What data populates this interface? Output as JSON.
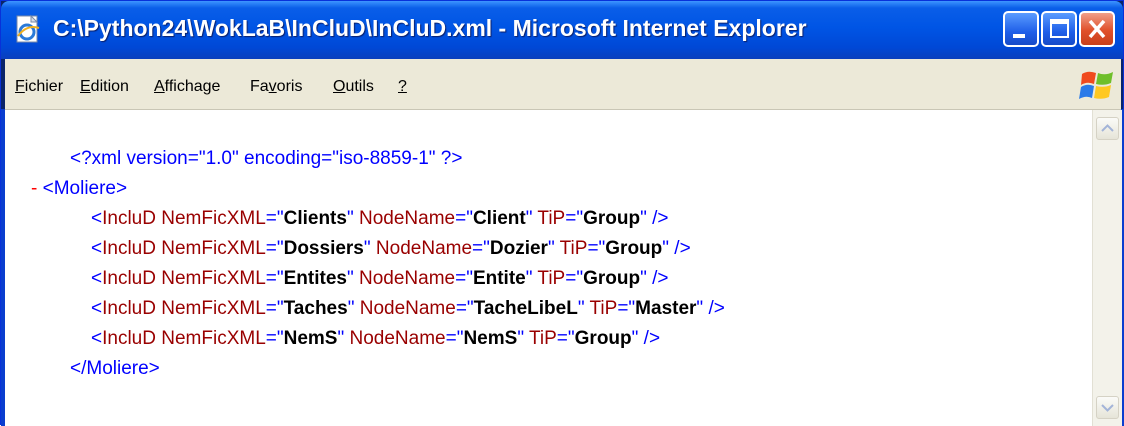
{
  "window": {
    "title": "C:\\Python24\\WokLaB\\InCluD\\InCluD.xml - Microsoft Internet Explorer"
  },
  "menu": {
    "items": [
      {
        "mnemonic": "F",
        "rest": "ichier"
      },
      {
        "mnemonic": "E",
        "rest": "dition"
      },
      {
        "mnemonic": "A",
        "rest": "ffichage"
      },
      {
        "pre": "Fa",
        "mnemonic": "v",
        "rest": "oris"
      },
      {
        "mnemonic": "O",
        "rest": "utils"
      },
      {
        "mnemonic": "?",
        "rest": ""
      }
    ]
  },
  "xml": {
    "declaration": "<?xml version=\"1.0\" encoding=\"iso-8859-1\" ?>",
    "collapse_marker": "-",
    "root_open": "<Moliere>",
    "root_close": "</Moliere>",
    "element_name": "IncluD",
    "attr1": "NemFicXML",
    "attr2": "NodeName",
    "attr3": "TiP",
    "rows": [
      {
        "nemficxml": "Clients",
        "nodename": "Client",
        "tip": "Group"
      },
      {
        "nemficxml": "Dossiers",
        "nodename": "Dozier",
        "tip": "Group"
      },
      {
        "nemficxml": "Entites",
        "nodename": "Entite",
        "tip": "Group"
      },
      {
        "nemficxml": "Taches",
        "nodename": "TacheLibeL",
        "tip": "Master"
      },
      {
        "nemficxml": "NemS",
        "nodename": "NemS",
        "tip": "Group"
      }
    ]
  },
  "colors": {
    "markup": "#0000ff",
    "names": "#990000",
    "values": "#000000",
    "collapse": "#ff0000",
    "titlebar": "#0055e5"
  },
  "icons": {
    "title": "ie-document-icon",
    "minimize": "minimize-icon",
    "maximize": "maximize-icon",
    "close": "close-icon",
    "brand": "windows-flag-icon",
    "scroll_up": "arrow-up-icon",
    "scroll_down": "arrow-down-icon"
  }
}
